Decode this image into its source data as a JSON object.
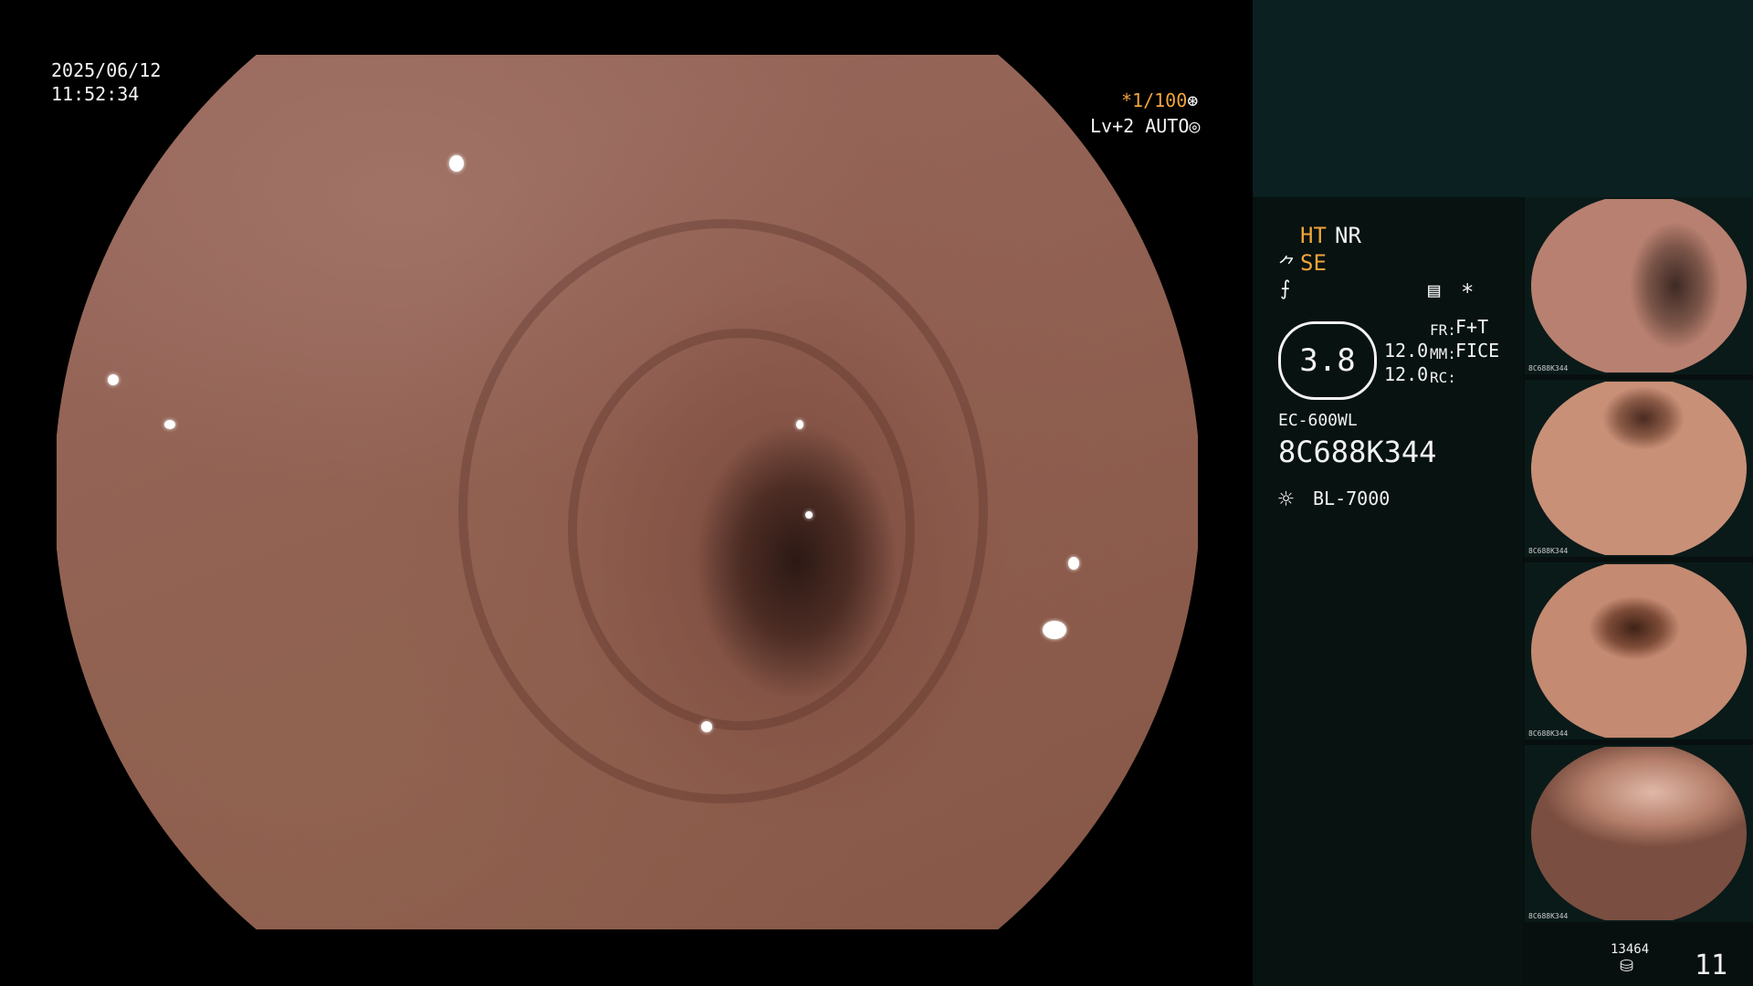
{
  "overlay": {
    "date": "2025/06/12",
    "time": "11:52:34",
    "shutter": "*1/100",
    "shutter_icon": "⊛",
    "level": "Lv+2 AUTO",
    "level_icon": "◎"
  },
  "info": {
    "ht": "HT",
    "nr": "NR",
    "se_icon": "⺈",
    "se": "SE",
    "enhance_icon": "⨍",
    "menu_icon": "▤",
    "star": "*",
    "zoom": "3.8",
    "fr_label": "FR:",
    "fr_value": "F+T",
    "mm_label": "MM:",
    "mm_value": "FICE",
    "rc_label": "RC:",
    "val1": "12.0",
    "val2": "12.0",
    "scope_model": "EC-600WL",
    "serial": "8C688K344",
    "light_icon": "☼",
    "light_source": "BL-7000"
  },
  "thumbnails": [
    {
      "caption": "8C688K344",
      "palette": [
        "#b88070",
        "#5a3a30"
      ]
    },
    {
      "caption": "8C688K344",
      "palette": [
        "#c99078",
        "#6a4030"
      ]
    },
    {
      "caption": "8C688K344",
      "palette": [
        "#c48a72",
        "#5e3626"
      ]
    },
    {
      "caption": "8C688K344",
      "palette": [
        "#d4a08c",
        "#7a4e40"
      ]
    }
  ],
  "footer": {
    "counter": "13464",
    "disk_icon": "⛁",
    "image_count": "11"
  },
  "colors": {
    "amber": "#f0a43a",
    "panel": "#07100f",
    "panel_top": "#0b2020"
  }
}
